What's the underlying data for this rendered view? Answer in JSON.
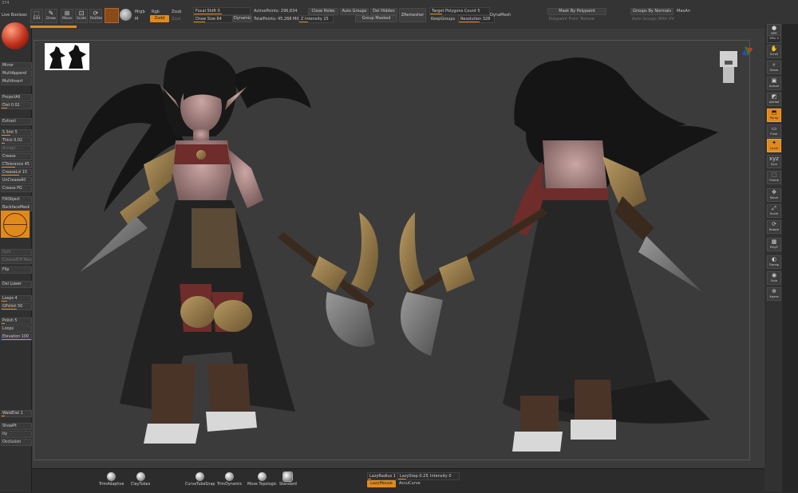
{
  "topbar": {
    "corner_label": "374",
    "live_boolean": "Live Boolean",
    "edit": "Edit",
    "draw": "Draw",
    "move": "Move",
    "scale": "Scale",
    "rotate": "RotAte",
    "mrgb": "Mrgb",
    "rgb": "Rgb",
    "m": "M",
    "zadd": "Zadd",
    "zsub": "Zsub",
    "zcut": "Zcut",
    "focal_shift": "Focal Shift 0",
    "draw_size": "Draw Size 64",
    "dynamic": "Dynamic",
    "active_points": "ActivePoints: 296,834",
    "total_points": "TotalPoints: 45.268 Mil",
    "z_intensity": "Z Intensity 25",
    "close_holes": "Close Holes",
    "auto_groups": "Auto Groups",
    "del_hidden": "Del Hidden",
    "group_masked": "Group Masked",
    "zremesher": "ZRemesher",
    "target_polygons": "Target Polygons Count 5",
    "keep_groups": "KeepGroups",
    "resolution": "Resolution 328",
    "dynamesh": "DynaMesh",
    "mask_by_polypaint": "Mask By Polypaint",
    "polypaint_from_texture": "Polypaint From Texture",
    "groups_by_normals": "Groups By Normals",
    "maxan": "MaxAn",
    "auto_groups_uv": "Auto Groups With UV"
  },
  "leftpanel": {
    "items": [
      {
        "label": "Mirror"
      },
      {
        "label": "MultiAppend"
      },
      {
        "label": "MultiInsert"
      },
      {
        "label": "ProjectAll"
      },
      {
        "label": "Dist 0.02"
      },
      {
        "label": "Extract"
      },
      {
        "label": "S Smt 5"
      },
      {
        "label": "Thick 0.02"
      },
      {
        "label": "Accept"
      },
      {
        "label": "Crease"
      },
      {
        "label": "CTolerance 45"
      },
      {
        "label": "CreaseLvl 15"
      },
      {
        "label": "UnCreaseAll"
      },
      {
        "label": "Crease PG"
      },
      {
        "label": "FillObject"
      },
      {
        "label": "BackfaceMask"
      },
      {
        "label": "Sym"
      },
      {
        "label": "CreaseDiff Mes"
      },
      {
        "label": "Flip"
      },
      {
        "label": "Del Lower"
      },
      {
        "label": "Loops 4"
      },
      {
        "label": "GPolish 50"
      },
      {
        "label": "Polish 5"
      },
      {
        "label": "Loops"
      },
      {
        "label": "Elevation 100"
      },
      {
        "label": "WeldDist 1"
      },
      {
        "label": "ShowPt"
      },
      {
        "label": "ity"
      },
      {
        "label": "Occlusion"
      }
    ]
  },
  "rightpanel": {
    "items": [
      {
        "label": "BPR",
        "icon": "sphere-icon"
      },
      {
        "label": "SPix 3",
        "icon": "none"
      },
      {
        "label": "Scroll",
        "icon": "hand-icon"
      },
      {
        "label": "Zoom",
        "icon": "magnifier-icon"
      },
      {
        "label": "Actual",
        "icon": "actual-icon"
      },
      {
        "label": "AAHalf",
        "icon": "aahalf-icon"
      },
      {
        "label": "Persp",
        "icon": "persp-icon"
      },
      {
        "label": "Floor",
        "icon": "floor-icon"
      },
      {
        "label": "Local",
        "icon": "local-icon"
      },
      {
        "label": "Sym",
        "icon": "sym-icon"
      },
      {
        "label": "Frame",
        "icon": "frame-icon"
      },
      {
        "label": "Move",
        "icon": "move-icon"
      },
      {
        "label": "Scale",
        "icon": "scale-icon"
      },
      {
        "label": "Rotate",
        "icon": "rotate-icon"
      },
      {
        "label": "PolyF",
        "icon": "polyf-icon"
      },
      {
        "label": "Transp",
        "icon": "transp-icon"
      },
      {
        "label": "Solo",
        "icon": "solo-icon"
      },
      {
        "label": "Xpose",
        "icon": "xpose-icon"
      }
    ]
  },
  "bottombar": {
    "brushes": [
      {
        "label": "TrimAdaptive"
      },
      {
        "label": "ClayTubes"
      },
      {
        "label": "CurveTubeSnap"
      },
      {
        "label": "TrimDynamic"
      },
      {
        "label": "Move Topologic"
      },
      {
        "label": "Standard"
      }
    ],
    "lazy_radius": "LazyRadius 1",
    "lazy_step": "LazyStep 0.25",
    "intensity": "Intensity 0",
    "lazy_mouse": "LazyMouse",
    "accu_curve": "AccuCurve"
  },
  "colors": {
    "accent": "#e08a1e",
    "panel": "#303030",
    "viewport": "#3b3b3b"
  }
}
